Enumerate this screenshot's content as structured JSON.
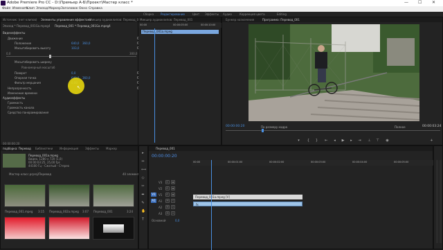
{
  "title": "Adobe Premiere Pro CC - D:\\Премьер А-Б\\Проект\\Мастер класс *",
  "window_controls": [
    "—",
    "☐",
    "✕"
  ],
  "menu": [
    "Файл",
    "Изменить",
    "Клип",
    "Эпизод",
    "Маркер",
    "Заголовок",
    "Окно",
    "Справка"
  ],
  "workspaces": [
    "Сборка",
    "Редактирование",
    "Цвет",
    "Эффекты",
    "Аудио",
    "Коррекция цвета",
    "Editing"
  ],
  "workspace_active": "Редактирование",
  "effect_controls": {
    "tabs": [
      "Источник: (нет клипов)",
      "Элементы управления эффектами",
      "Микшер аудиоклипов: Перевод_001",
      "Метаданные"
    ],
    "active_tab": "Элементы управления эффектами",
    "header": "Эпизод * Перевод_001Ga.mpeg4",
    "clip_header": "Перевод_001 * Перевод_001Ga.mpeg4",
    "section_video": "Видеоэффекты",
    "fx_motion": "Движение",
    "position_label": "Положение",
    "position_x": "640,0",
    "position_y": "360,0",
    "scale_height_label": "Масштабировать высоту",
    "scale_height": "103,0",
    "scale_min": "0,0",
    "scale_max": "300,0",
    "scale_width_label": "Масштабировать ширину",
    "uniform_scale": "Равномерный масштаб",
    "rotation_label": "Поворот",
    "rotation": "0,0",
    "anchor_label": "Опорная точка",
    "anchor_x": "640,0",
    "anchor_y": "360,0",
    "flicker_label": "Фильтр мерцания",
    "flicker": "0,00",
    "opacity": "Непрозрачность",
    "time_remap": "Изменение времени",
    "section_audio": "Аудиоэффекты",
    "volume": "Громкость",
    "channel_volume": "Громкость канала",
    "panner": "Средство панорамирования",
    "timecode": "00:00:00:20",
    "ruler_start": "00:00",
    "ruler_marks": [
      "00:00:05:00",
      "00:00:10:00"
    ],
    "clip_bar": "Перевод_001a.mpeg"
  },
  "program": {
    "tabs": [
      "Бункер назначения",
      "Программа: Перевод_001"
    ],
    "active_tab": "Программа: Перевод_001",
    "timecode_left": "00:00:00:20",
    "fit": "По размеру кадра",
    "quality": "Полное",
    "timecode_right": "00:00:03:24"
  },
  "project": {
    "tabs": [
      "подборка: Перевод",
      "Библиотеки",
      "Информация",
      "Эффекты",
      "Маркер"
    ],
    "active_tab": "подборка: Перевод",
    "clip_name": "Перевод_001a.mpeg",
    "clip_info": [
      "Видео, 1280 x 720 (1,0)",
      "00:00:03:25, 25,00 fps",
      "44100 Гц - Сжатый - Стерео"
    ],
    "footer": "Мастер класс.prproj/Перевод",
    "count": "40 элементов",
    "items": [
      {
        "name": "Перевод_001.mpeg",
        "dur": "3:15"
      },
      {
        "name": "Перевод_002a.mpeg",
        "dur": "3:07"
      },
      {
        "name": "Перевод_001",
        "dur": "3:24"
      },
      {
        "name": "",
        "dur": ""
      },
      {
        "name": "",
        "dur": ""
      },
      {
        "name": "",
        "dur": ""
      }
    ]
  },
  "timeline": {
    "tab": "Перевод_001",
    "timecode": "00:00:00:20",
    "ruler": [
      "00:00",
      "00:00:01:00",
      "00:00:02:00",
      "00:00:03:00",
      "00:00:04:00",
      "00:00:05:00"
    ],
    "tracks": [
      "V3",
      "V2",
      "V1",
      "A1",
      "A2",
      "A3"
    ],
    "video_clip": "Перевод_001a.mpeg [V]",
    "audio_clip": "fx",
    "master": "Основной",
    "master_value": "0,0"
  },
  "tools": [
    "▸",
    "⇔",
    "⟺",
    "◇",
    "✂",
    "⬌",
    "✎",
    "✋",
    "T"
  ],
  "colors": {
    "accent": "#4f8fe6",
    "playhead": "#4a90e2",
    "cursor": "#f2e10c",
    "video_clip": "#d9d9d9",
    "audio_clip": "#9fc5e8"
  }
}
